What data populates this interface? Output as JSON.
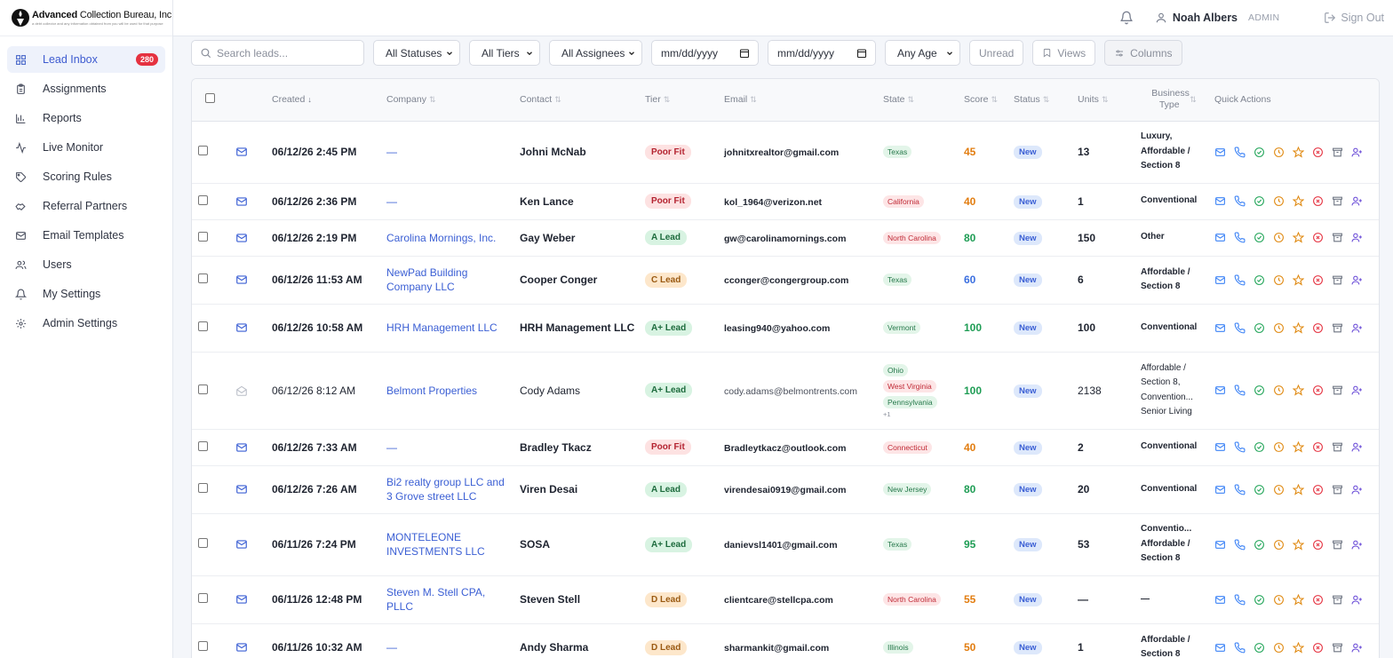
{
  "brand": {
    "name_bold": "Advanced",
    "name_rest": " Collection Bureau, Inc",
    "tagline": "a debt collector and any information obtained from you will be used for that purpose"
  },
  "sidebar": {
    "items": [
      {
        "label": "Lead Inbox",
        "icon": "grid-icon",
        "active": true,
        "badge": "280"
      },
      {
        "label": "Assignments",
        "icon": "clipboard-icon"
      },
      {
        "label": "Reports",
        "icon": "bar-chart-icon"
      },
      {
        "label": "Live Monitor",
        "icon": "activity-icon"
      },
      {
        "label": "Scoring Rules",
        "icon": "tag-icon"
      },
      {
        "label": "Referral Partners",
        "icon": "handshake-icon"
      },
      {
        "label": "Email Templates",
        "icon": "mail-icon"
      },
      {
        "label": "Users",
        "icon": "users-icon"
      },
      {
        "label": "My Settings",
        "icon": "bell-icon"
      },
      {
        "label": "Admin Settings",
        "icon": "gear-icon"
      }
    ]
  },
  "topbar": {
    "user_name": "Noah Albers",
    "role": "ADMIN",
    "signout": "Sign Out"
  },
  "filters": {
    "search_placeholder": "Search leads...",
    "status": "All Statuses",
    "tier": "All Tiers",
    "assignee": "All Assignees",
    "date_from": "mm/dd/yyyy",
    "date_to": "mm/dd/yyyy",
    "age": "Any Age",
    "unread": "Unread",
    "views": "Views",
    "columns": "Columns"
  },
  "table": {
    "headers": {
      "created": "Created",
      "company": "Company",
      "contact": "Contact",
      "tier": "Tier",
      "email": "Email",
      "state": "State",
      "score": "Score",
      "status": "Status",
      "units": "Units",
      "business_type": "Business Type",
      "quick_actions": "Quick Actions"
    },
    "rows": [
      {
        "unread": true,
        "created": "06/12/26 2:45 PM",
        "company": "—",
        "contact": "Johni McNab",
        "tier": "Poor Fit",
        "tier_class": "poor",
        "email": "johnitxrealtor@gmail.com",
        "states": [
          {
            "name": "Texas",
            "c": "g"
          }
        ],
        "score": "45",
        "score_class": "orange",
        "status": "New",
        "units": "13",
        "btype": [
          "Luxury,",
          "Affordable /",
          "Section 8"
        ],
        "h": 70
      },
      {
        "unread": true,
        "created": "06/12/26 2:36 PM",
        "company": "—",
        "contact": "Ken Lance",
        "tier": "Poor Fit",
        "tier_class": "poor",
        "email": "kol_1964@verizon.net",
        "states": [
          {
            "name": "California",
            "c": "r"
          }
        ],
        "score": "40",
        "score_class": "orange",
        "status": "New",
        "units": "1",
        "btype": [
          "Conventional"
        ],
        "h": 41
      },
      {
        "unread": true,
        "created": "06/12/26 2:19 PM",
        "company": "Carolina Mornings, Inc.",
        "contact": "Gay Weber",
        "tier": "A Lead",
        "tier_class": "a",
        "email": "gw@carolinamornings.com",
        "states": [
          {
            "name": "North Carolina",
            "c": "r"
          }
        ],
        "score": "80",
        "score_class": "green",
        "status": "New",
        "units": "150",
        "btype": [
          "Other"
        ],
        "h": 41
      },
      {
        "unread": true,
        "created": "06/12/26 11:53 AM",
        "company": "NewPad Building Company LLC",
        "contact": "Cooper Conger",
        "tier": "C Lead",
        "tier_class": "c",
        "email": "cconger@congergroup.com",
        "states": [
          {
            "name": "Texas",
            "c": "g"
          }
        ],
        "score": "60",
        "score_class": "blue",
        "status": "New",
        "units": "6",
        "btype": [
          "Affordable /",
          "Section 8"
        ],
        "h": 54
      },
      {
        "unread": true,
        "created": "06/12/26 10:58 AM",
        "company": "HRH Management LLC",
        "contact": "HRH Management LLC",
        "tier": "A+ Lead",
        "tier_class": "a",
        "email": "leasing940@yahoo.com",
        "states": [
          {
            "name": "Vermont",
            "c": "g"
          }
        ],
        "score": "100",
        "score_class": "green",
        "status": "New",
        "units": "100",
        "btype": [
          "Conventional"
        ],
        "h": 54
      },
      {
        "unread": false,
        "created": "06/12/26 8:12 AM",
        "company": "Belmont Properties",
        "contact": "Cody Adams",
        "tier": "A+ Lead",
        "tier_class": "a",
        "email": "cody.adams@belmontrents.com",
        "states": [
          {
            "name": "Ohio",
            "c": "g"
          },
          {
            "name": "West Virginia",
            "c": "r"
          },
          {
            "name": "Pennsylvania",
            "c": "g"
          }
        ],
        "state_more": "+1",
        "score": "100",
        "score_class": "green",
        "status": "New",
        "units": "2138",
        "btype": [
          "Affordable /",
          "Section 8,",
          "Convention...",
          "Senior Living"
        ],
        "h": 87
      },
      {
        "unread": true,
        "created": "06/12/26 7:33 AM",
        "company": "—",
        "contact": "Bradley Tkacz",
        "tier": "Poor Fit",
        "tier_class": "poor",
        "email": "Bradleytkacz@outlook.com",
        "states": [
          {
            "name": "Connecticut",
            "c": "r"
          }
        ],
        "score": "40",
        "score_class": "orange",
        "status": "New",
        "units": "2",
        "btype": [
          "Conventional"
        ],
        "h": 41
      },
      {
        "unread": true,
        "created": "06/12/26 7:26 AM",
        "company": "Bi2 realty group LLC and 3 Grove street LLC",
        "contact": "Viren Desai",
        "tier": "A Lead",
        "tier_class": "a",
        "email": "virendesai0919@gmail.com",
        "states": [
          {
            "name": "New Jersey",
            "c": "g"
          }
        ],
        "score": "80",
        "score_class": "green",
        "status": "New",
        "units": "20",
        "btype": [
          "Conventional"
        ],
        "h": 54
      },
      {
        "unread": true,
        "created": "06/11/26 7:24 PM",
        "company": "MONTELEONE INVESTMENTS LLC",
        "contact": "SOSA",
        "tier": "A+ Lead",
        "tier_class": "a",
        "email": "danievsl1401@gmail.com",
        "states": [
          {
            "name": "Texas",
            "c": "g"
          }
        ],
        "score": "95",
        "score_class": "green",
        "status": "New",
        "units": "53",
        "btype": [
          "Conventio...",
          "Affordable /",
          "Section 8"
        ],
        "h": 70
      },
      {
        "unread": true,
        "created": "06/11/26 12:48 PM",
        "company": "Steven M. Stell CPA, PLLC",
        "contact": "Steven Stell",
        "tier": "D Lead",
        "tier_class": "d",
        "email": "clientcare@stellcpa.com",
        "states": [
          {
            "name": "North Carolina",
            "c": "r"
          }
        ],
        "score": "55",
        "score_class": "orange",
        "status": "New",
        "units": "—",
        "btype": [
          "—"
        ],
        "h": 54
      },
      {
        "unread": true,
        "created": "06/11/26 10:32 AM",
        "company": "—",
        "contact": "Andy Sharma",
        "tier": "D Lead",
        "tier_class": "d",
        "email": "sharmankit@gmail.com",
        "states": [
          {
            "name": "Illinois",
            "c": "g"
          }
        ],
        "score": "50",
        "score_class": "orange",
        "status": "New",
        "units": "1",
        "btype": [
          "Affordable /",
          "Section 8"
        ],
        "h": 54
      }
    ],
    "quick_actions": [
      {
        "icon": "mail-icon",
        "color": "#3b82f6"
      },
      {
        "icon": "phone-icon",
        "color": "#3b82f6"
      },
      {
        "icon": "check-circle-icon",
        "color": "#22a559"
      },
      {
        "icon": "clock-icon",
        "color": "#e08a12"
      },
      {
        "icon": "star-icon",
        "color": "#e08a12"
      },
      {
        "icon": "x-circle-icon",
        "color": "#e53240"
      },
      {
        "icon": "archive-icon",
        "color": "#6b7280"
      },
      {
        "icon": "user-plus-icon",
        "color": "#6d4fd8"
      }
    ]
  }
}
